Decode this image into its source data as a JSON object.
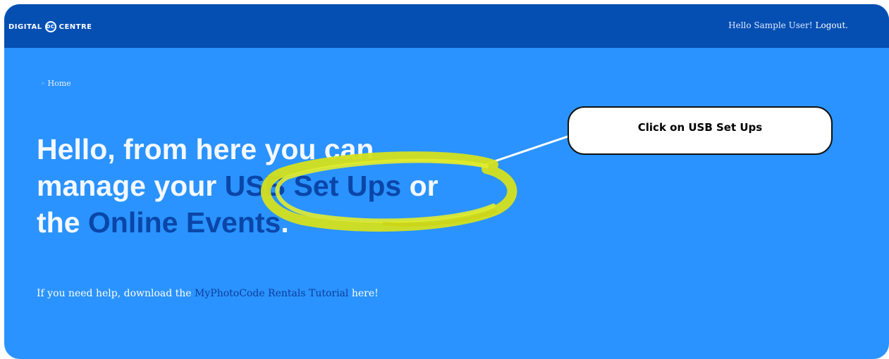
{
  "header": {
    "brand_left": "DIGITAL",
    "brand_badge": "DC",
    "brand_right": "CENTRE",
    "greeting": "Hello Sample User!",
    "logout": "Logout."
  },
  "breadcrumb": {
    "caret": "»",
    "home": "Home"
  },
  "headline": {
    "line1": "Hello, from here you can",
    "line2_prefix": "manage your ",
    "usb_link": "USB Set Ups",
    "line2_suffix": " or",
    "line3_prefix": "the ",
    "events_link": "Online Events",
    "line3_suffix": "."
  },
  "help": {
    "prefix": "If you need help, download the ",
    "tutorial_link": "MyPhotoCode Rentals Tutorial",
    "suffix": " here!"
  },
  "annotation": {
    "callout_text": "Click on USB Set Ups",
    "highlight_color": "#d4e01e"
  },
  "colors": {
    "topbar": "#064fb2",
    "background": "#2a93ff",
    "link": "#0a46a8"
  }
}
